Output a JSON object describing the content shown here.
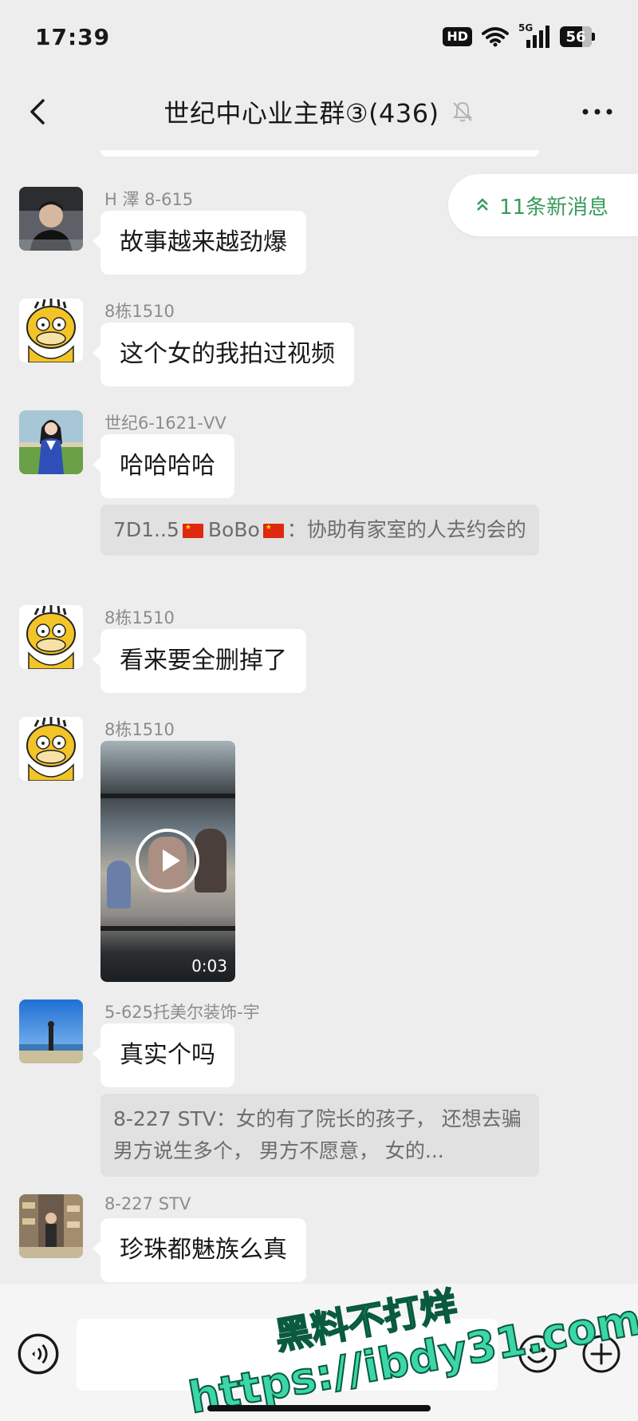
{
  "status_bar": {
    "time": "17:39",
    "hd_label": "HD",
    "network_label": "5G",
    "battery_level": "56",
    "icons": [
      "wifi-icon",
      "signal-icon",
      "battery-icon"
    ]
  },
  "nav": {
    "title": "世纪中心业主群③(436)",
    "icons": [
      "back-icon",
      "mute-bell-icon",
      "more-icon"
    ]
  },
  "new_messages": {
    "label": "11条新消息",
    "icon": "double-chevron-up-icon"
  },
  "messages": [
    {
      "sender": "H 澤 8-615",
      "text": "故事越来越劲爆"
    },
    {
      "sender": "8栋1510",
      "text": "这个女的我拍过视频"
    },
    {
      "sender": "世纪6-1621-VV",
      "text": "哈哈哈哈",
      "quote": {
        "prefix": "7D1..5",
        "name": "BoBo",
        "text": "：协助有家室的人去约会的"
      }
    },
    {
      "sender": "8栋1510",
      "text": "看来要全删掉了"
    },
    {
      "sender": "8栋1510",
      "video_duration": "0:03"
    },
    {
      "sender": "5-625托美尔装饰-宇",
      "text": "真实个吗",
      "quote": {
        "text": "8-227 STV：女的有了院长的孩子， 还想去骗男方说生多个， 男方不愿意， 女的..."
      }
    },
    {
      "sender": "8-227 STV",
      "text": "珍珠都魅族么真"
    }
  ],
  "input_bar": {
    "placeholder": "",
    "icons": [
      "voice-icon",
      "emoji-icon",
      "plus-icon"
    ]
  },
  "watermark": {
    "line1": "黑料不打烊",
    "line2": "https://ibdy31.com"
  },
  "colors": {
    "background": "#ededed",
    "bubble": "#ffffff",
    "quote": "#e1e1e1",
    "accent_green": "#3a9b5c",
    "watermark_green": "#3cd6a8"
  }
}
